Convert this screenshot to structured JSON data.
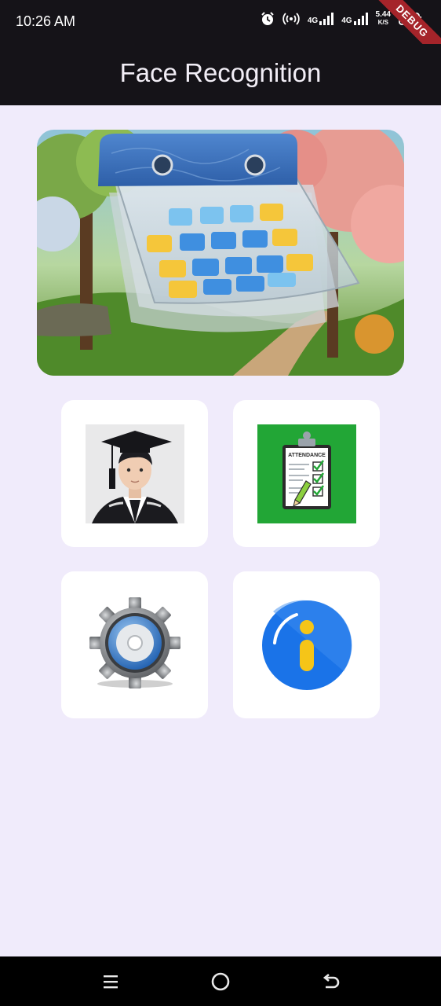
{
  "status": {
    "time": "10:26 AM",
    "net1": "4G",
    "net2": "4G",
    "speed_value": "5.44",
    "speed_unit": "K/S",
    "debug_label": "DEBUG",
    "icons": [
      "alarm-icon",
      "hotspot-icon",
      "signal-icon",
      "signal-icon",
      "battery-icon"
    ]
  },
  "app_bar": {
    "title": "Face Recognition"
  },
  "hero": {
    "icon": "calendar-illustration"
  },
  "tiles": [
    {
      "icon": "graduate-student-icon"
    },
    {
      "icon": "attendance-clipboard-icon",
      "label": "ATTENDANCE"
    },
    {
      "icon": "gear-icon"
    },
    {
      "icon": "info-icon"
    }
  ],
  "nav": {
    "icons": [
      "menu-icon",
      "home-icon",
      "back-icon"
    ]
  }
}
